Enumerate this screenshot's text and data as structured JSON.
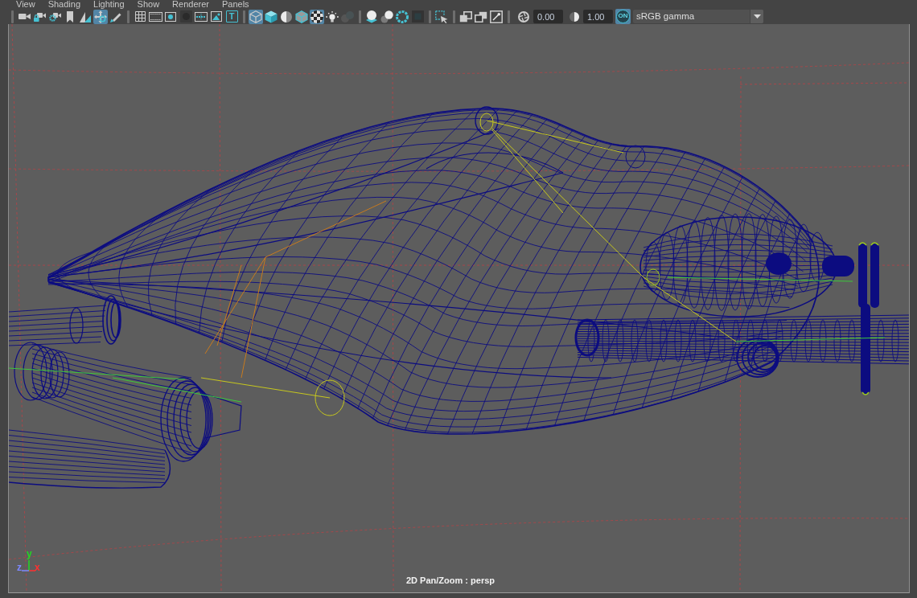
{
  "menu": [
    "View",
    "Shading",
    "Lighting",
    "Show",
    "Renderer",
    "Panels"
  ],
  "toolbar": [
    [
      {
        "selected": false,
        "disabled": false
      },
      {
        "selected": false,
        "disabled": false
      },
      {
        "selected": false,
        "disabled": false
      },
      {
        "selected": false,
        "disabled": false
      },
      {
        "selected": false,
        "disabled": false
      },
      {
        "selected": true,
        "disabled": false
      },
      {
        "selected": false,
        "disabled": false
      }
    ],
    [
      {
        "selected": false,
        "disabled": false
      },
      {
        "selected": false,
        "disabled": false
      },
      {
        "selected": false,
        "disabled": false
      },
      {
        "selected": false,
        "disabled": false
      },
      {
        "selected": false,
        "disabled": false
      },
      {
        "selected": false,
        "disabled": false
      },
      {
        "label": "T",
        "selected": false,
        "disabled": false
      }
    ],
    [
      {
        "selected": true,
        "disabled": false
      },
      {
        "selected": false,
        "disabled": false
      },
      {
        "selected": false,
        "disabled": false
      },
      {
        "selected": false,
        "disabled": false
      },
      {
        "selected": true,
        "disabled": false
      },
      {
        "selected": false,
        "disabled": false
      },
      {
        "selected": false,
        "disabled": true
      }
    ],
    [
      {
        "selected": false,
        "disabled": false
      },
      {
        "selected": false,
        "disabled": false
      },
      {
        "selected": false,
        "disabled": false
      },
      {
        "selected": false,
        "disabled": false
      }
    ],
    [
      {
        "selected": false,
        "disabled": false
      }
    ],
    [
      {
        "selected": false,
        "disabled": false
      },
      {
        "selected": false,
        "disabled": false
      },
      {
        "selected": false,
        "disabled": false
      }
    ]
  ],
  "exposure": {
    "value": "0.00"
  },
  "gamma": {
    "value": "1.00"
  },
  "color_management": {
    "label": "ON",
    "selected": true
  },
  "view_transform": {
    "value": "sRGB gamma"
  },
  "viewport": {
    "camera_label": "2D Pan/Zoom : persp",
    "axes": [
      {
        "label": "x",
        "color": "#ff3030"
      },
      {
        "label": "y",
        "color": "#22d822"
      },
      {
        "label": "z",
        "color": "#7d88ff"
      }
    ]
  }
}
